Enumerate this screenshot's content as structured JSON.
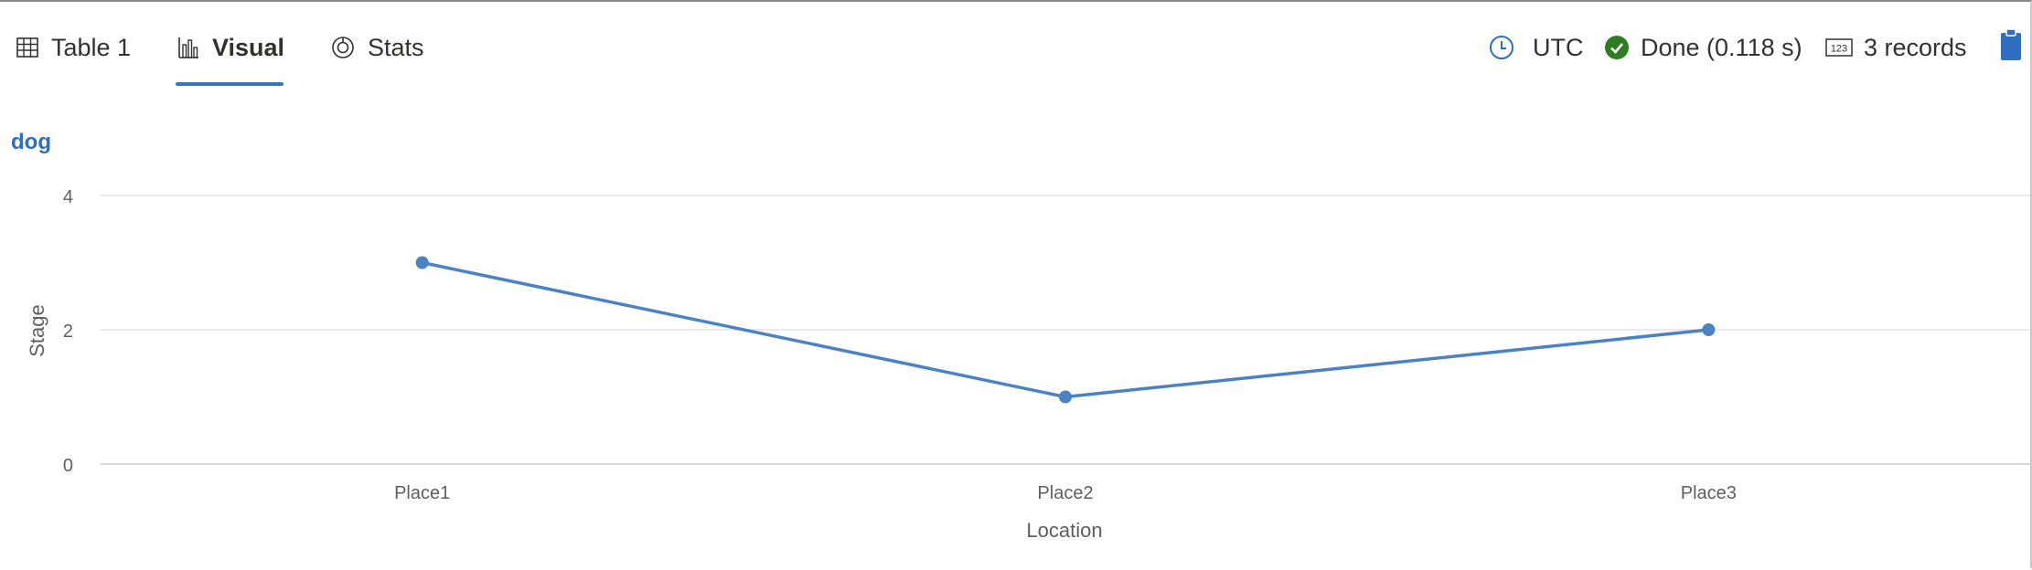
{
  "tabs": [
    {
      "label": "Table 1",
      "icon": "table-icon",
      "active": false
    },
    {
      "label": "Visual",
      "icon": "bar-chart-icon",
      "active": true
    },
    {
      "label": "Stats",
      "icon": "stats-icon",
      "active": false
    }
  ],
  "status": {
    "timezone": "UTC",
    "done_text": "Done (0.118 s)",
    "records_text": "3 records",
    "records_icon_text": "123"
  },
  "colors": {
    "accent": "#3b73c4",
    "series": "#4a82c4",
    "done_green": "#2e7d22",
    "clipboard": "#2f6fc1"
  },
  "chart_data": {
    "type": "line",
    "title": "dog",
    "categories": [
      "Place1",
      "Place2",
      "Place3"
    ],
    "series": [
      {
        "values": [
          3,
          1,
          2
        ]
      }
    ],
    "xlabel": "Location",
    "ylabel": "Stage",
    "ylim": [
      0,
      4
    ],
    "yticks": [
      0,
      2,
      4
    ],
    "grid": true,
    "legend": "none"
  }
}
